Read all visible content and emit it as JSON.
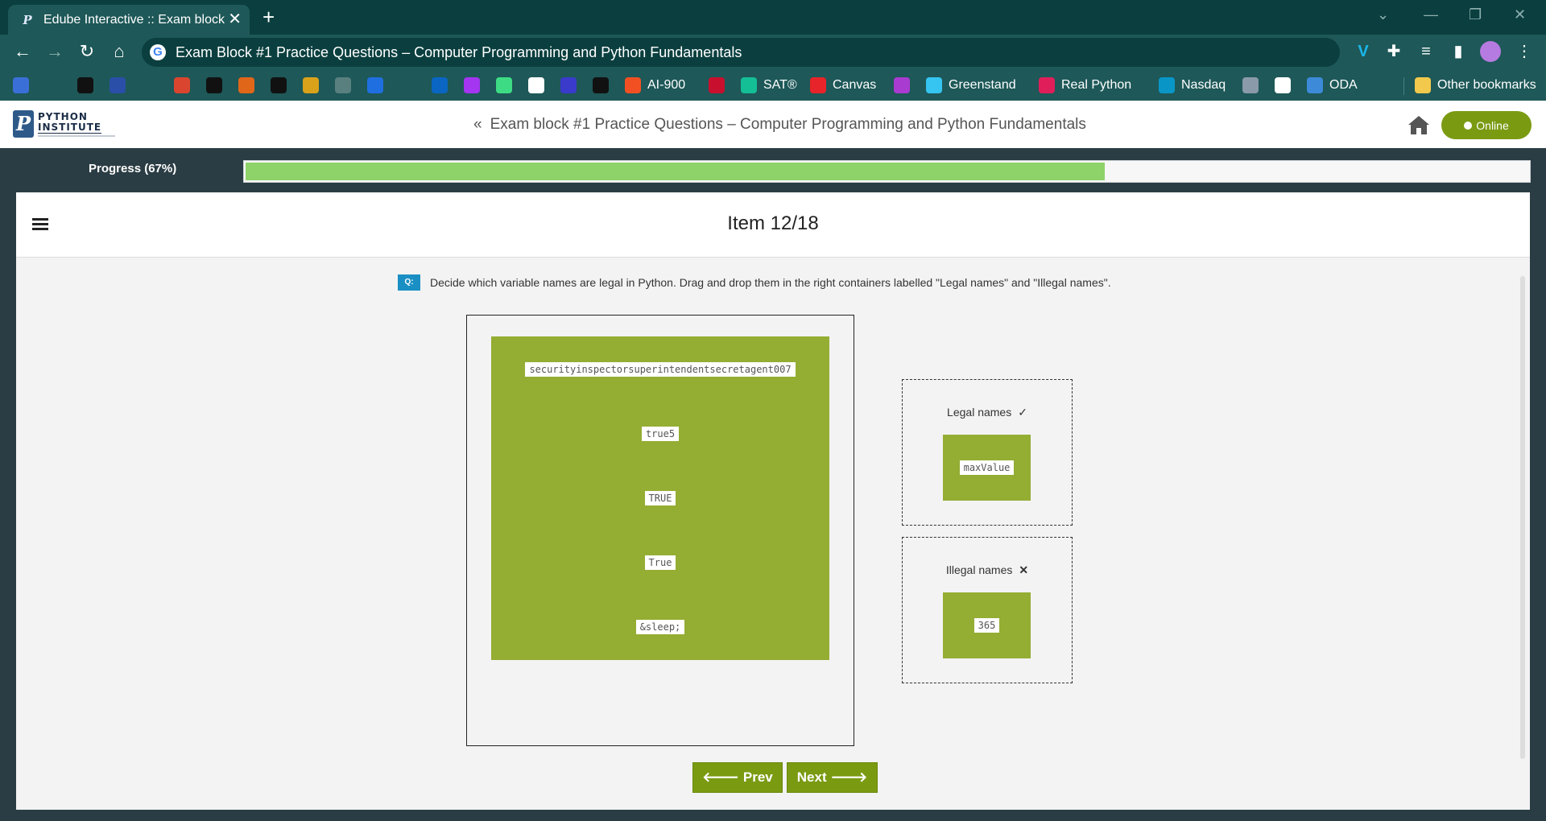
{
  "browser": {
    "tab": {
      "title": "Edube Interactive :: Exam block #",
      "icon": "python-institute-favicon"
    },
    "url": "Exam Block #1 Practice Questions – Computer Programming and Python Fundamentals",
    "bookmarks": [
      {
        "label": "",
        "icon": "layers-icon",
        "color": "#3b6fd8"
      },
      {
        "label": "",
        "icon": "github-icon",
        "color": "#1e5858"
      },
      {
        "label": "",
        "icon": "circle-logo-icon",
        "color": "#111111"
      },
      {
        "label": "",
        "icon": "pycharm-icon",
        "color": "#2a4fa8"
      },
      {
        "label": "",
        "icon": "printer-icon",
        "color": "#1e5858"
      },
      {
        "label": "",
        "icon": "spiral-icon",
        "color": "#d9452e"
      },
      {
        "label": "",
        "icon": "lambda-icon",
        "color": "#111111"
      },
      {
        "label": "",
        "icon": "stripes-icon",
        "color": "#e0661a"
      },
      {
        "label": "",
        "icon": "hackerrank-icon",
        "color": "#111111"
      },
      {
        "label": "",
        "icon": "arrow-logo-icon",
        "color": "#d9a21a"
      },
      {
        "label": "",
        "icon": "dots-icon",
        "color": "#5a7f7f"
      },
      {
        "label": "",
        "icon": "coursera-icon",
        "color": "#1f6fe0"
      },
      {
        "label": "",
        "icon": "edx-icon",
        "color": "#1e5858"
      },
      {
        "label": "",
        "icon": "linkedin-icon",
        "color": "#0a66c2"
      },
      {
        "label": "",
        "icon": "udemy-icon",
        "color": "#a435f0"
      },
      {
        "label": "",
        "icon": "android-icon",
        "color": "#3ddc84"
      },
      {
        "label": "",
        "icon": "code-icon",
        "color": "#ffffff"
      },
      {
        "label": "",
        "icon": "bracket-icon",
        "color": "#3a3acb"
      },
      {
        "label": "",
        "icon": "terminal-icon",
        "color": "#111111"
      },
      {
        "label": "AI-900",
        "icon": "microsoft-icon",
        "color": "#f25022"
      },
      {
        "label": "",
        "icon": "shield-icon",
        "color": "#c8102e"
      },
      {
        "label": "SAT®",
        "icon": "khan-icon",
        "color": "#14bf96"
      },
      {
        "label": "Canvas",
        "icon": "canvas-icon",
        "color": "#e72429"
      },
      {
        "label": "",
        "icon": "ed-icon",
        "color": "#a93bd1"
      },
      {
        "label": "Greenstand",
        "icon": "slack-icon",
        "color": "#36c5f0"
      },
      {
        "label": "Real Python",
        "icon": "slack-icon",
        "color": "#e01e5a"
      },
      {
        "label": "Nasdaq",
        "icon": "nasdaq-icon",
        "color": "#0996c7"
      },
      {
        "label": "",
        "icon": "aai-icon",
        "color": "#8a9aa8"
      },
      {
        "label": "",
        "icon": "mw-icon",
        "color": "#ffffff"
      },
      {
        "label": "ODA",
        "icon": "dollar-icon",
        "color": "#3c8ad8"
      }
    ],
    "other_bookmarks": "Other bookmarks"
  },
  "site": {
    "logo_line1": "PYTHON",
    "logo_line2": "INSTITUTE",
    "header_title": "Exam block #1 Practice Questions – Computer Programming and Python Fundamentals",
    "online_label": "Online"
  },
  "progress": {
    "label": "Progress (67%)",
    "value": 0.67
  },
  "item": {
    "title": "Item 12/18",
    "question_badge": "Q:",
    "question": "Decide which variable names are legal in Python. Drag and drop them in the right containers labelled \"Legal names\" and \"Illegal names\".",
    "source_tiles": [
      "securityinspectorsuperintendentsecretagent007",
      "true5",
      "TRUE",
      "True",
      "&sleep;"
    ],
    "legal": {
      "label": "Legal names",
      "mark": "✓",
      "tiles": [
        "maxValue"
      ]
    },
    "illegal": {
      "label": "Illegal names",
      "mark": "✕",
      "tiles": [
        "365"
      ]
    },
    "prev_label": "Prev",
    "next_label": "Next"
  },
  "colors": {
    "accent": "#7a9a12",
    "tile": "#94ad33",
    "progress": "#8ed26a",
    "chrome": "#1e5858"
  }
}
